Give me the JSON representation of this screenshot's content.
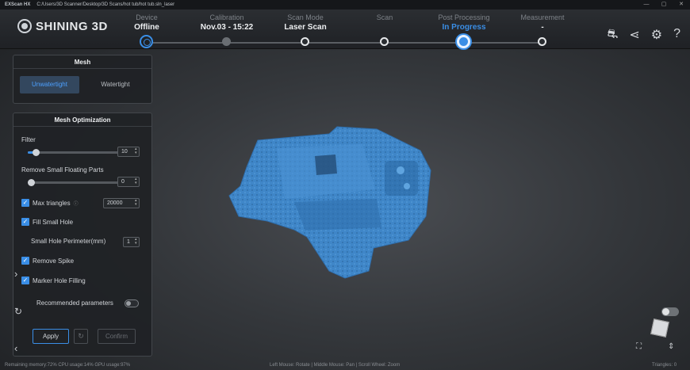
{
  "titlebar": {
    "app": "EXScan HX",
    "path": "C:/Users/3D Scanner/Desktop/3D Scans/hot tub/hot tub.sln_laser",
    "min": "—",
    "max": "▢",
    "close": "✕"
  },
  "brand": {
    "name": "SHINING 3D"
  },
  "steps": [
    {
      "label": "Device",
      "value": "Offline"
    },
    {
      "label": "Calibration",
      "value": "Nov.03 - 15:22"
    },
    {
      "label": "Scan Mode",
      "value": "Laser Scan"
    },
    {
      "label": "Scan",
      "value": ""
    },
    {
      "label": "Post Processing",
      "value": "In Progress"
    },
    {
      "label": "Measurement",
      "value": "-"
    }
  ],
  "top_icons": [
    "error-report-icon",
    "share-icon",
    "settings-icon",
    "help-icon"
  ],
  "mesh_panel": {
    "title": "Mesh",
    "options": [
      "Unwatertight",
      "Watertight"
    ],
    "selected": "Unwatertight"
  },
  "optimization": {
    "title": "Mesh Optimization",
    "filter": {
      "label": "Filter",
      "value": "10",
      "level": 0.08
    },
    "floating": {
      "label": "Remove Small Floating Parts",
      "value": "0",
      "level": 0.0
    },
    "max_triangles": {
      "label": "Max triangles",
      "value": "20000",
      "checked": true
    },
    "fill_small_hole": {
      "label": "Fill Small Hole",
      "checked": true
    },
    "hole_perimeter": {
      "label": "Small Hole Perimeter(mm)",
      "value": "1"
    },
    "remove_spike": {
      "label": "Remove Spike",
      "checked": true
    },
    "marker_hole": {
      "label": "Marker Hole Filling",
      "checked": true
    },
    "recommended": {
      "label": "Recommended parameters",
      "on": false
    },
    "apply_label": "Apply",
    "confirm_label": "Confirm"
  },
  "statusbar": {
    "left": "Remaining memory:72% CPU usage:14% GPU usage:97%",
    "center": "Left Mouse: Rotate | Middle Mouse: Pan | Scroll Wheel: Zoom",
    "right": "Triangles: 0"
  },
  "colors": {
    "accent": "#3a8ee6",
    "model": "#3f86c8"
  }
}
